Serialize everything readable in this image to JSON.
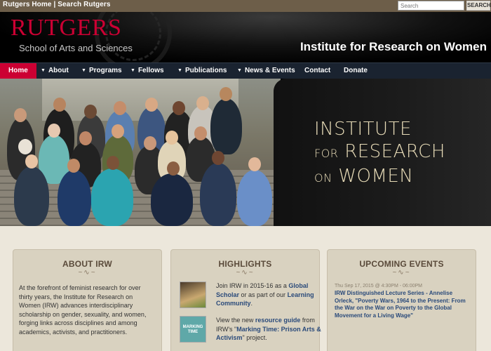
{
  "topbar": {
    "rutgers_home": "Rutgers Home",
    "separator": "|",
    "search_rutgers": "Search Rutgers",
    "search_placeholder": "Search",
    "search_button": "SEARCH"
  },
  "header": {
    "logo": "RUTGERS",
    "logo_subtitle": "School of Arts and Sciences",
    "institute_title": "Institute for Research on Women"
  },
  "nav": {
    "items": [
      {
        "label": "Home",
        "active": true
      },
      {
        "label": "About",
        "dropdown": true
      },
      {
        "label": "Programs",
        "dropdown": true
      },
      {
        "label": "Fellows",
        "dropdown": true
      },
      {
        "label": "Publications",
        "dropdown": true
      },
      {
        "label": "News & Events",
        "dropdown": true
      },
      {
        "label": "Contact"
      },
      {
        "label": "Donate"
      }
    ]
  },
  "hero": {
    "line1": "Institute",
    "line2_small": "for",
    "line2": "Research",
    "line3_small": "on",
    "line3": "Women"
  },
  "about": {
    "heading": "ABOUT IRW",
    "text": "At the forefront of feminist research for over thirty years, the Institute for Research on Women (IRW) advances interdisciplinary scholarship on gender, sexuality, and women, forging links across disciplines and among academics, activists, and practitioners."
  },
  "highlights": {
    "heading": "HIGHLIGHTS",
    "item1_pre": "Join IRW in 2015-16 as a ",
    "item1_link1": "Global Scholar",
    "item1_mid": " or as part of our ",
    "item1_link2": "Learning Community",
    "item1_post": ".",
    "item2_pre": "View the new ",
    "item2_link1": "resource guide",
    "item2_mid": " from IRW's \"",
    "item2_link2": "Marking Time: Prison Arts & Activism",
    "item2_post": "\" project.",
    "thumb2_label": "MARKING TIME"
  },
  "events": {
    "heading": "UPCOMING EVENTS",
    "date": "Thu Sep 17, 2015 @ 4:30PM - 06:00PM",
    "title": "IRW Distinguished Lecture Series - Annelise Orleck, \"Poverty Wars, 1964 to the Present: From the War on the War on Poverty to the Global Movement for a Living Wage\""
  },
  "colors": {
    "accent": "#cc0033",
    "nav_bg": "#1a2330",
    "link": "#2a4a7a"
  }
}
